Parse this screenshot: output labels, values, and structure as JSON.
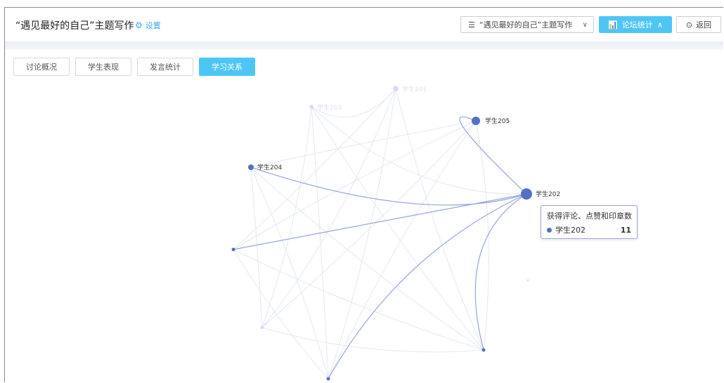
{
  "header": {
    "title": "“遇见最好的自己”主题写作",
    "settings_label": "设置",
    "topic_select_value": "“遇见最好的自己”主题写作",
    "stats_button_label": "论坛统计",
    "back_button_label": "返回"
  },
  "tabs": [
    {
      "label": "讨论概况",
      "active": false
    },
    {
      "label": "学生表现",
      "active": false
    },
    {
      "label": "发言统计",
      "active": false
    },
    {
      "label": "学习关系",
      "active": true
    }
  ],
  "graph": {
    "node_color": "#5470c6",
    "labels": {
      "s201": "学生201",
      "s203": "学生203",
      "s205": "学生205",
      "s204": "学生204",
      "s202": "学生202"
    }
  },
  "tooltip": {
    "title": "获得评论、点赞和印章数",
    "name": "学生202",
    "value": "11"
  },
  "colors": {
    "accent": "#4ec6f5",
    "node": "#5470c6",
    "link": "#5470c6"
  }
}
